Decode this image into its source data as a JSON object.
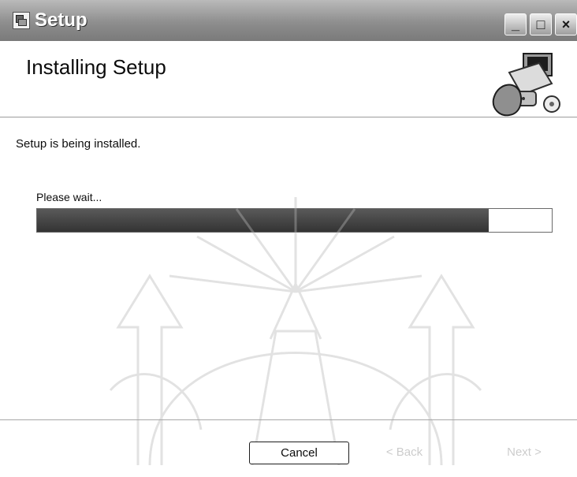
{
  "window": {
    "title": "Setup",
    "controls": {
      "minimize": "_",
      "maximize": "□",
      "close": "×"
    }
  },
  "header": {
    "title": "Installing Setup",
    "image_icon": "computer-illustration-icon"
  },
  "content": {
    "status_text": "Setup is being installed.",
    "progress_label": "Please wait...",
    "progress": 0.88
  },
  "footer": {
    "cancel_label": "Cancel",
    "back_label": "< Back",
    "next_label": "Next >"
  },
  "colors": {
    "titlebar": "#8d8d8d",
    "progress_fill": "#3f3f3f",
    "background": "#ffffff"
  },
  "overlay": {
    "watermark_icon": "temple-watermark-icon"
  }
}
